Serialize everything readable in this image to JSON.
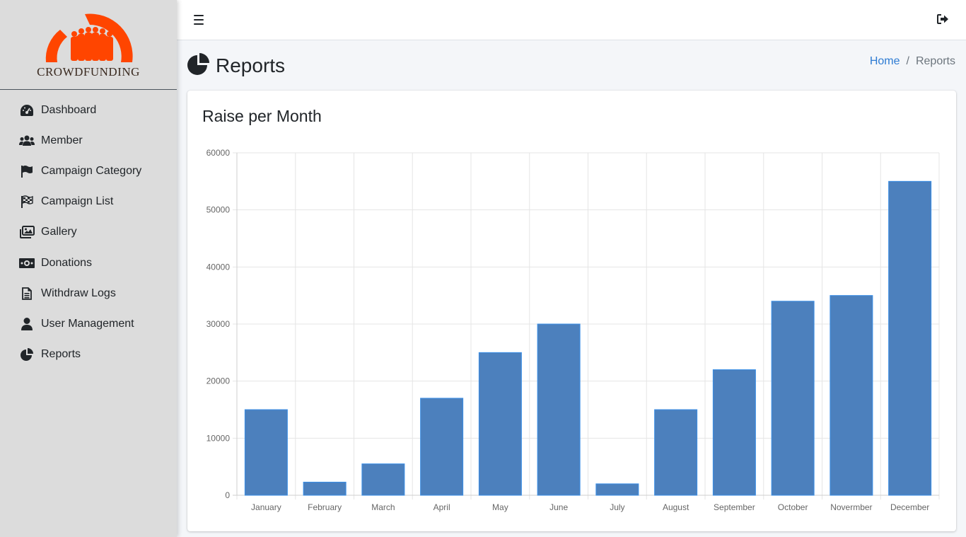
{
  "brand": {
    "name": "CROWDFUNDING",
    "logo_icon": "crowd-arc-logo",
    "logo_color": "#ff4500"
  },
  "sidebar": {
    "items": [
      {
        "label": "Dashboard",
        "icon": "tachometer-icon"
      },
      {
        "label": "Member",
        "icon": "users-icon"
      },
      {
        "label": "Campaign Category",
        "icon": "flag-icon"
      },
      {
        "label": "Campaign List",
        "icon": "flag-checkered-icon"
      },
      {
        "label": "Gallery",
        "icon": "images-icon"
      },
      {
        "label": "Donations",
        "icon": "money-bill-icon"
      },
      {
        "label": "Withdraw Logs",
        "icon": "file-alt-icon"
      },
      {
        "label": "User Management",
        "icon": "user-icon"
      },
      {
        "label": "Reports",
        "icon": "chart-pie-icon"
      }
    ]
  },
  "topbar": {
    "menu_icon": "bars-icon",
    "logout_icon": "sign-out-icon"
  },
  "header": {
    "title": "Reports",
    "title_icon": "chart-pie-icon",
    "breadcrumb": {
      "home": "Home",
      "separator": "/",
      "current": "Reports"
    }
  },
  "card": {
    "title": "Raise per Month"
  },
  "colors": {
    "bar_fill": "#4c80bd",
    "bar_border": "#3a8ee6",
    "link": "#2d7bd3"
  },
  "chart_data": {
    "type": "bar",
    "title": "",
    "xlabel": "",
    "ylabel": "",
    "categories": [
      "January",
      "February",
      "March",
      "April",
      "May",
      "June",
      "July",
      "August",
      "September",
      "October",
      "Novermber",
      "December"
    ],
    "values": [
      15000,
      2300,
      5500,
      17000,
      25000,
      30000,
      2000,
      15000,
      22000,
      34000,
      35000,
      55000
    ],
    "ylim": [
      0,
      60000
    ],
    "yticks": [
      0,
      10000,
      20000,
      30000,
      40000,
      50000,
      60000
    ],
    "grid": true,
    "legend": "none"
  }
}
